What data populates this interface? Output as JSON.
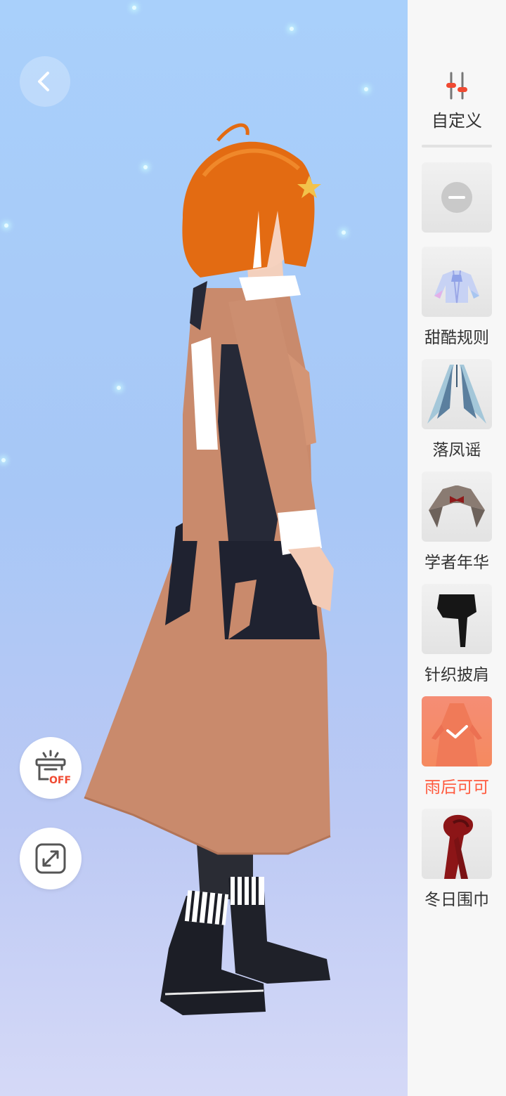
{
  "sidebar": {
    "custom_label": "自定义",
    "none_option": "none",
    "items": [
      {
        "label": "甜酷规则",
        "selected": false,
        "icon": "jacket-icon"
      },
      {
        "label": "落凤谣",
        "selected": false,
        "icon": "cape-icon"
      },
      {
        "label": "学者年华",
        "selected": false,
        "icon": "collar-icon"
      },
      {
        "label": "针织披肩",
        "selected": false,
        "icon": "shawl-icon"
      },
      {
        "label": "雨后可可",
        "selected": true,
        "icon": "coat-icon"
      },
      {
        "label": "冬日围巾",
        "selected": false,
        "icon": "scarf-icon"
      }
    ]
  },
  "controls": {
    "back": "back-icon",
    "background_toggle": "OFF",
    "fullscreen": "expand-icon"
  },
  "colors": {
    "accent": "#ff5a3e",
    "slider_knob": "#f04a32",
    "selected_tile": "#f58a5f",
    "stage_top": "#a9d0fb",
    "stage_bottom": "#d5d9f7"
  }
}
